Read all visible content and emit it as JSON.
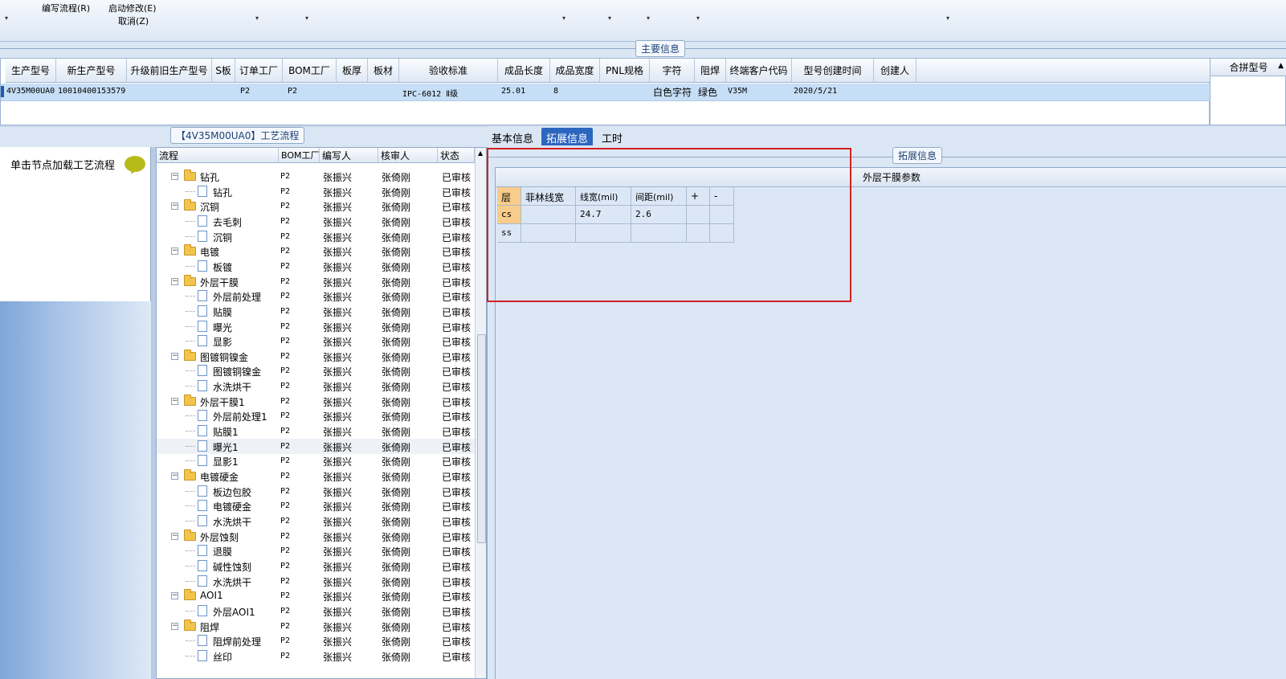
{
  "toolbar": {
    "items": [
      {
        "label": "编写流程(R)"
      },
      {
        "label": "启动修改(E)"
      },
      {
        "label": "取消(Z)"
      }
    ]
  },
  "main_info": {
    "caption": "主要信息",
    "columns": [
      "生产型号",
      "新生产型号",
      "升级前旧生产型号",
      "S板",
      "订单工厂",
      "BOM工厂",
      "板厚",
      "板材",
      "验收标准",
      "成品长度",
      "成品宽度",
      "PNL规格",
      "字符",
      "阻焊",
      "终端客户代码",
      "型号创建时间",
      "创建人"
    ],
    "row": {
      "生产型号": "4V35M00UA0",
      "新生产型号": "10010400153579",
      "订单工厂": "P2",
      "BOM工厂": "P2",
      "验收标准": "IPC-6012 Ⅱ级",
      "成品长度": "25.01",
      "成品宽度": "8",
      "字符": "白色字符",
      "阻焊": "绿色",
      "终端客户代码": "V35M",
      "型号创建时间": "2020/5/21"
    },
    "merge_header": "合拼型号"
  },
  "left_panel": {
    "load_label": "单击节点加载工艺流程"
  },
  "process_tree": {
    "caption": "【4V35M00UA0】工艺流程",
    "columns": [
      "流程",
      "BOM工厂",
      "编写人",
      "核审人",
      "状态"
    ],
    "rows": [
      {
        "name": "钻孔",
        "level": 0,
        "bom": "P2",
        "writer": "张振兴",
        "reviewer": "张倚刚",
        "status": "已审核"
      },
      {
        "name": "钻孔",
        "level": 1,
        "bom": "P2",
        "writer": "张振兴",
        "reviewer": "张倚刚",
        "status": "已审核"
      },
      {
        "name": "沉铜",
        "level": 0,
        "bom": "P2",
        "writer": "张振兴",
        "reviewer": "张倚刚",
        "status": "已审核"
      },
      {
        "name": "去毛刺",
        "level": 1,
        "bom": "P2",
        "writer": "张振兴",
        "reviewer": "张倚刚",
        "status": "已审核"
      },
      {
        "name": "沉铜",
        "level": 1,
        "bom": "P2",
        "writer": "张振兴",
        "reviewer": "张倚刚",
        "status": "已审核"
      },
      {
        "name": "电镀",
        "level": 0,
        "bom": "P2",
        "writer": "张振兴",
        "reviewer": "张倚刚",
        "status": "已审核"
      },
      {
        "name": "板镀",
        "level": 1,
        "bom": "P2",
        "writer": "张振兴",
        "reviewer": "张倚刚",
        "status": "已审核"
      },
      {
        "name": "外层干膜",
        "level": 0,
        "bom": "P2",
        "writer": "张振兴",
        "reviewer": "张倚刚",
        "status": "已审核"
      },
      {
        "name": "外层前处理",
        "level": 1,
        "bom": "P2",
        "writer": "张振兴",
        "reviewer": "张倚刚",
        "status": "已审核"
      },
      {
        "name": "贴膜",
        "level": 1,
        "bom": "P2",
        "writer": "张振兴",
        "reviewer": "张倚刚",
        "status": "已审核"
      },
      {
        "name": "曝光",
        "level": 1,
        "bom": "P2",
        "writer": "张振兴",
        "reviewer": "张倚刚",
        "status": "已审核"
      },
      {
        "name": "显影",
        "level": 1,
        "bom": "P2",
        "writer": "张振兴",
        "reviewer": "张倚刚",
        "status": "已审核"
      },
      {
        "name": "图镀铜镍金",
        "level": 0,
        "bom": "P2",
        "writer": "张振兴",
        "reviewer": "张倚刚",
        "status": "已审核"
      },
      {
        "name": "图镀铜镍金",
        "level": 1,
        "bom": "P2",
        "writer": "张振兴",
        "reviewer": "张倚刚",
        "status": "已审核"
      },
      {
        "name": "水洗烘干",
        "level": 1,
        "bom": "P2",
        "writer": "张振兴",
        "reviewer": "张倚刚",
        "status": "已审核"
      },
      {
        "name": "外层干膜1",
        "level": 0,
        "bom": "P2",
        "writer": "张振兴",
        "reviewer": "张倚刚",
        "status": "已审核"
      },
      {
        "name": "外层前处理1",
        "level": 1,
        "bom": "P2",
        "writer": "张振兴",
        "reviewer": "张倚刚",
        "status": "已审核"
      },
      {
        "name": "贴膜1",
        "level": 1,
        "bom": "P2",
        "writer": "张振兴",
        "reviewer": "张倚刚",
        "status": "已审核"
      },
      {
        "name": "曝光1",
        "level": 1,
        "bom": "P2",
        "writer": "张振兴",
        "reviewer": "张倚刚",
        "status": "已审核"
      },
      {
        "name": "显影1",
        "level": 1,
        "bom": "P2",
        "writer": "张振兴",
        "reviewer": "张倚刚",
        "status": "已审核"
      },
      {
        "name": "电镀硬金",
        "level": 0,
        "bom": "P2",
        "writer": "张振兴",
        "reviewer": "张倚刚",
        "status": "已审核"
      },
      {
        "name": "板边包胶",
        "level": 1,
        "bom": "P2",
        "writer": "张振兴",
        "reviewer": "张倚刚",
        "status": "已审核"
      },
      {
        "name": "电镀硬金",
        "level": 1,
        "bom": "P2",
        "writer": "张振兴",
        "reviewer": "张倚刚",
        "status": "已审核"
      },
      {
        "name": "水洗烘干",
        "level": 1,
        "bom": "P2",
        "writer": "张振兴",
        "reviewer": "张倚刚",
        "status": "已审核"
      },
      {
        "name": "外层蚀刻",
        "level": 0,
        "bom": "P2",
        "writer": "张振兴",
        "reviewer": "张倚刚",
        "status": "已审核"
      },
      {
        "name": "退膜",
        "level": 1,
        "bom": "P2",
        "writer": "张振兴",
        "reviewer": "张倚刚",
        "status": "已审核"
      },
      {
        "name": "碱性蚀刻",
        "level": 1,
        "bom": "P2",
        "writer": "张振兴",
        "reviewer": "张倚刚",
        "status": "已审核"
      },
      {
        "name": "水洗烘干",
        "level": 1,
        "bom": "P2",
        "writer": "张振兴",
        "reviewer": "张倚刚",
        "status": "已审核"
      },
      {
        "name": "AOI1",
        "level": 0,
        "bom": "P2",
        "writer": "张振兴",
        "reviewer": "张倚刚",
        "status": "已审核"
      },
      {
        "name": "外层AOI1",
        "level": 1,
        "bom": "P2",
        "writer": "张振兴",
        "reviewer": "张倚刚",
        "status": "已审核"
      },
      {
        "name": "阻焊",
        "level": 0,
        "bom": "P2",
        "writer": "张振兴",
        "reviewer": "张倚刚",
        "status": "已审核"
      },
      {
        "name": "阻焊前处理",
        "level": 1,
        "bom": "P2",
        "writer": "张振兴",
        "reviewer": "张倚刚",
        "status": "已审核"
      },
      {
        "name": "丝印",
        "level": 1,
        "bom": "P2",
        "writer": "张振兴",
        "reviewer": "张倚刚",
        "status": "已审核"
      }
    ]
  },
  "tabs": {
    "items": [
      "基本信息",
      "拓展信息",
      "工时"
    ],
    "active": "拓展信息"
  },
  "ext_info": {
    "caption": "拓展信息",
    "section_title": "外层干膜参数",
    "table": {
      "headers": [
        "层",
        "菲林线宽",
        "线宽(mil)",
        "间距(mil)",
        "+",
        "-"
      ],
      "rows": [
        {
          "layer": "cs",
          "film_width": "",
          "width": "24.7",
          "spacing": "2.6"
        },
        {
          "layer": "ss",
          "film_width": "",
          "width": "",
          "spacing": ""
        }
      ]
    }
  },
  "colors": {
    "tab_active": "#2d66bf",
    "selected_row": "#c6def6",
    "highlight_box": "#d42020",
    "header_accent": "#f8cc8a"
  }
}
